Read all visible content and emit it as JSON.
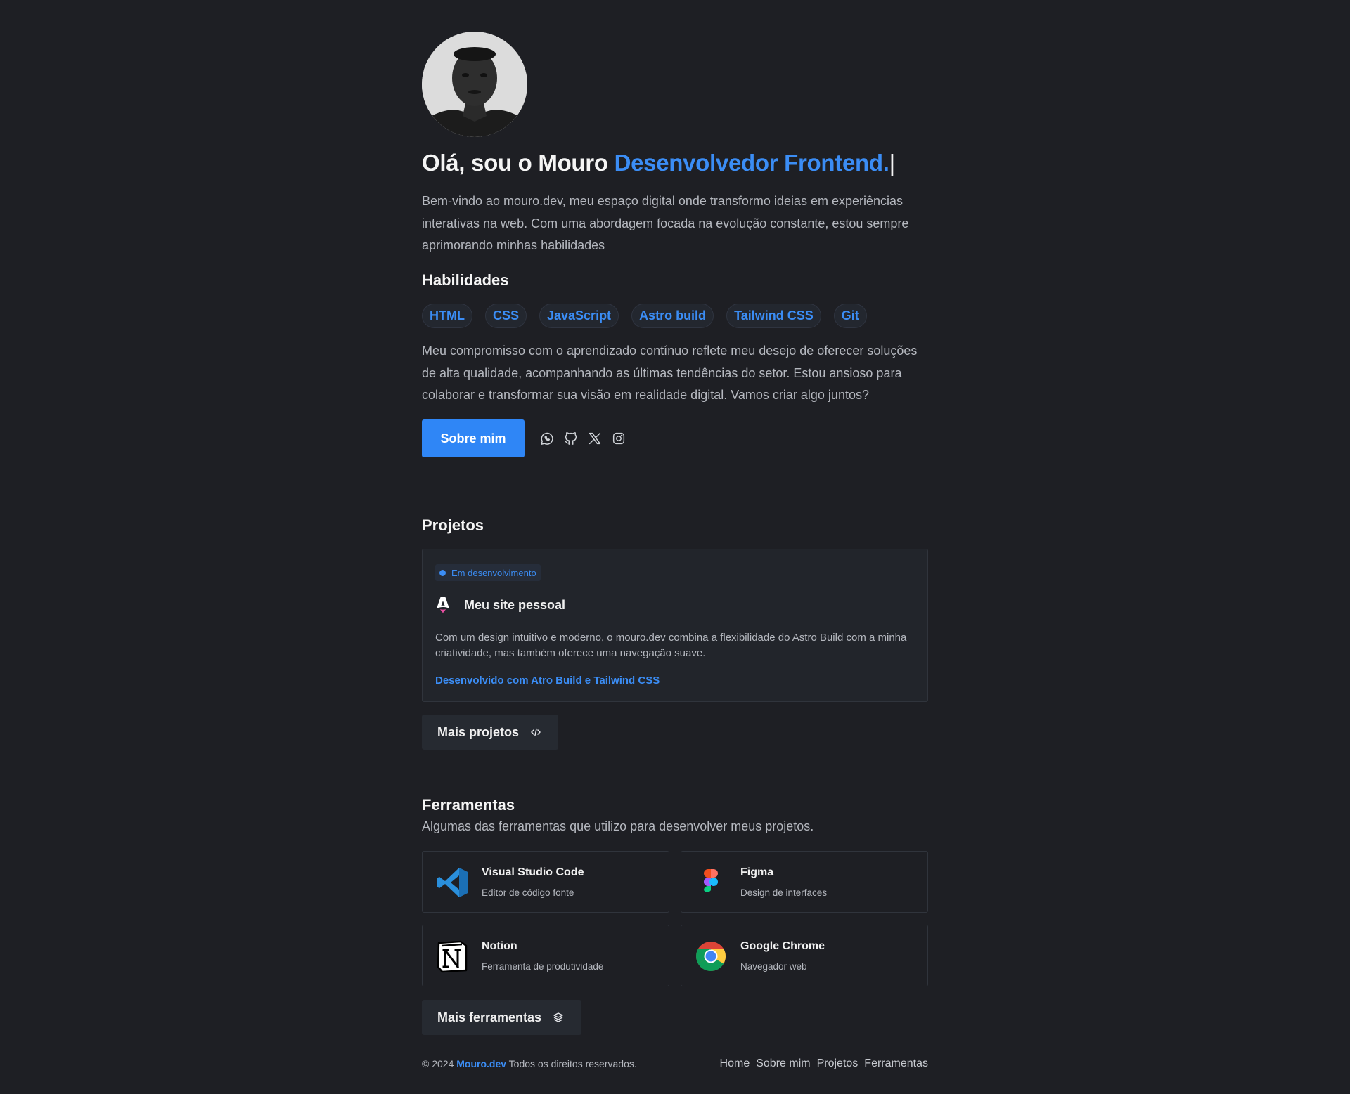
{
  "hero": {
    "title_plain": "Olá, sou o Mouro ",
    "title_accent": "Desenvolvedor Frontend.",
    "caret": "|",
    "intro": "Bem-vindo ao mouro.dev, meu espaço digital onde transformo ideias em experiências interativas na web. Com uma abordagem focada na evolução constante, estou sempre aprimorando minhas habilidades"
  },
  "skills": {
    "heading": "Habilidades",
    "items": [
      "HTML",
      "CSS",
      "JavaScript",
      "Astro build",
      "Tailwind CSS",
      "Git"
    ]
  },
  "commitment": "Meu compromisso com o aprendizado contínuo reflete meu desejo de oferecer soluções de alta qualidade, acompanhando as últimas tendências do setor. Estou ansioso para colaborar e transformar sua visão em realidade digital. Vamos criar algo juntos?",
  "cta": {
    "about_label": "Sobre mim",
    "socials": [
      "whatsapp-icon",
      "github-icon",
      "x-icon",
      "instagram-icon"
    ]
  },
  "projects": {
    "heading": "Projetos",
    "card": {
      "badge": "Em desenvolvimento",
      "title": "Meu site pessoal",
      "description": "Com um design intuitivo e moderno, o mouro.dev combina a flexibilidade do Astro Build com a minha criatividade, mas também oferece uma navegação suave.",
      "link": "Desenvolvido com Atro Build e Tailwind CSS"
    },
    "more_label": "Mais projetos"
  },
  "tools": {
    "heading": "Ferramentas",
    "subtitle": "Algumas das ferramentas que utilizo para desenvolver meus projetos.",
    "items": [
      {
        "name": "Visual Studio Code",
        "desc": "Editor de código fonte",
        "icon": "vscode-icon"
      },
      {
        "name": "Figma",
        "desc": "Design de interfaces",
        "icon": "figma-icon"
      },
      {
        "name": "Notion",
        "desc": "Ferramenta de produtividade",
        "icon": "notion-icon"
      },
      {
        "name": "Google Chrome",
        "desc": "Navegador web",
        "icon": "chrome-icon"
      }
    ],
    "more_label": "Mais ferramentas"
  },
  "footer": {
    "copyright_prefix": "© 2024 ",
    "brand": "Mouro.dev",
    "copyright_suffix": " Todos os direitos reservados.",
    "nav": [
      "Home",
      "Sobre mim",
      "Projetos",
      "Ferramentas"
    ]
  },
  "colors": {
    "background": "#1e1f24",
    "accent": "#3b8df5",
    "button": "#2f86f6"
  }
}
